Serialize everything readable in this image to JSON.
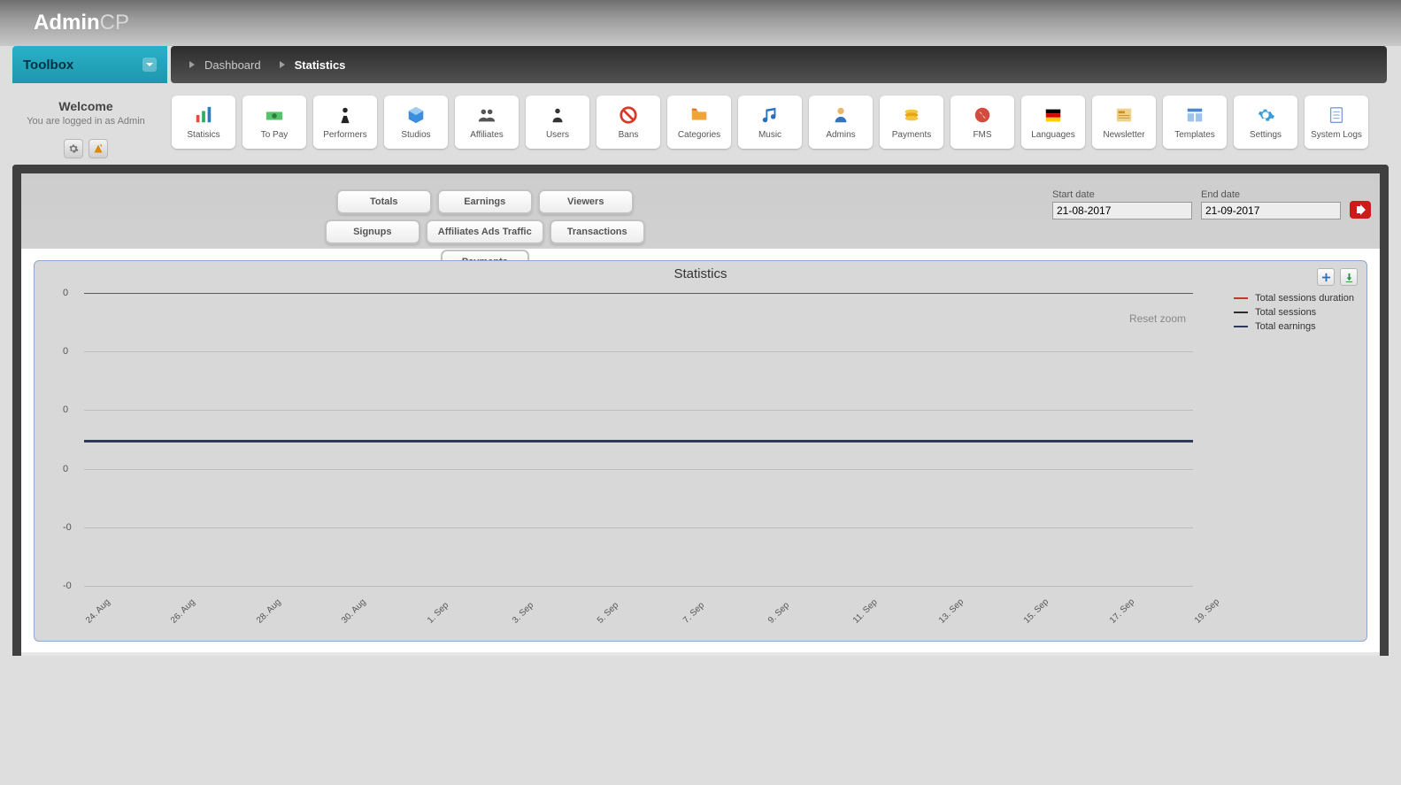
{
  "brand": {
    "a": "Admin",
    "b": "CP"
  },
  "toolbox_label": "Toolbox",
  "breadcrumb": {
    "dashboard": "Dashboard",
    "statistics": "Statistics"
  },
  "welcome": {
    "title": "Welcome",
    "subtitle": "You are logged in as Admin"
  },
  "tiles": [
    "Statisics",
    "To Pay",
    "Performers",
    "Studios",
    "Affiliates",
    "Users",
    "Bans",
    "Categories",
    "Music",
    "Admins",
    "Payments",
    "FMS",
    "Languages",
    "Newsletter",
    "Templates",
    "Settings",
    "System Logs"
  ],
  "tabs": [
    "Totals",
    "Earnings",
    "Viewers",
    "Signups",
    "Affiliates Ads Traffic",
    "Transactions",
    "Payments"
  ],
  "date": {
    "start_label": "Start date",
    "end_label": "End date",
    "start_value": "21-08-2017",
    "end_value": "21-09-2017"
  },
  "chart": {
    "title": "Statistics",
    "reset_zoom": "Reset zoom",
    "legend": [
      {
        "label": "Total sessions duration",
        "color": "#c0392b"
      },
      {
        "label": "Total sessions",
        "color": "#2c2c2c"
      },
      {
        "label": "Total earnings",
        "color": "#2f3a5a"
      }
    ]
  },
  "chart_data": {
    "type": "line",
    "title": "Statistics",
    "xlabel": "",
    "ylabel": "",
    "ylim": [
      -0.1,
      0.1
    ],
    "y_ticks": [
      "0",
      "0",
      "0",
      "0",
      "-0",
      "-0"
    ],
    "categories": [
      "24. Aug",
      "26. Aug",
      "28. Aug",
      "30. Aug",
      "1. Sep",
      "3. Sep",
      "5. Sep",
      "7. Sep",
      "9. Sep",
      "11. Sep",
      "13. Sep",
      "15. Sep",
      "17. Sep",
      "19. Sep"
    ],
    "series": [
      {
        "name": "Total sessions duration",
        "color": "#c0392b",
        "values": [
          0,
          0,
          0,
          0,
          0,
          0,
          0,
          0,
          0,
          0,
          0,
          0,
          0,
          0
        ]
      },
      {
        "name": "Total sessions",
        "color": "#2c2c2c",
        "values": [
          0,
          0,
          0,
          0,
          0,
          0,
          0,
          0,
          0,
          0,
          0,
          0,
          0,
          0
        ]
      },
      {
        "name": "Total earnings",
        "color": "#2f3a5a",
        "values": [
          0,
          0,
          0,
          0,
          0,
          0,
          0,
          0,
          0,
          0,
          0,
          0,
          0,
          0
        ]
      }
    ]
  }
}
